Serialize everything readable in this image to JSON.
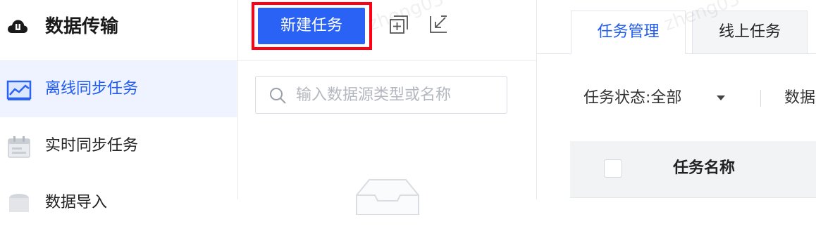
{
  "app": {
    "title": "数据传输",
    "logo_icon": "cloud-upload-icon"
  },
  "sidebar": {
    "items": [
      {
        "label": "离线同步任务",
        "icon": "chart-monitor-icon",
        "active": true
      },
      {
        "label": "实时同步任务",
        "icon": "calendar-icon",
        "active": false
      },
      {
        "label": "数据导入",
        "icon": "database-icon",
        "active": false
      }
    ]
  },
  "toolbar": {
    "new_task_label": "新建任务",
    "add_icon": "add-square-icon",
    "import_icon": "import-arrow-icon"
  },
  "search": {
    "placeholder": "输入数据源类型或名称",
    "icon": "search-icon"
  },
  "tabs": [
    {
      "label": "任务管理",
      "active": true
    },
    {
      "label": "线上任务",
      "active": false
    }
  ],
  "filters": {
    "status_label": "任务状态:",
    "status_value": "全部",
    "second_label": "数据"
  },
  "table": {
    "columns": [
      "任务名称"
    ]
  },
  "watermark": "zheng03",
  "colors": {
    "primary": "#2a62f5",
    "highlight_frame": "#ff0015",
    "active_text": "#1f5bf0",
    "active_bg": "#eef3ff"
  }
}
